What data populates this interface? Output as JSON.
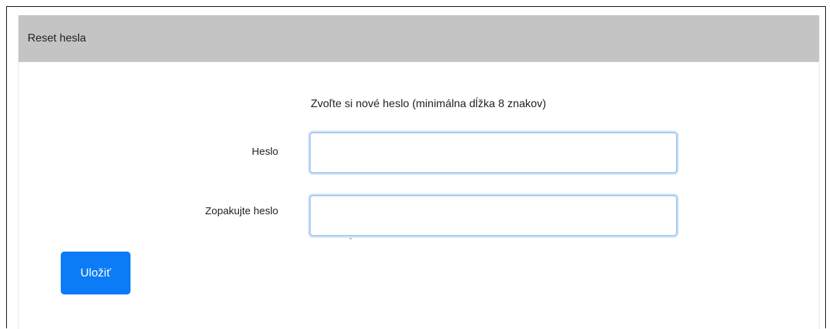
{
  "header": {
    "title": "Reset hesla"
  },
  "form": {
    "hint": "Zvoľte si nové heslo (minimálna dĺžka 8 znakov)",
    "password_label": "Heslo",
    "password_value": "",
    "repeat_label": "Zopakujte heslo",
    "repeat_value": "",
    "tick_glyph": "ˇ"
  },
  "actions": {
    "save_label": "Uložiť"
  },
  "colors": {
    "header_bg": "#c4c4c4",
    "accent": "#0b7cf5",
    "input_focus_border": "#a9c9f2"
  }
}
